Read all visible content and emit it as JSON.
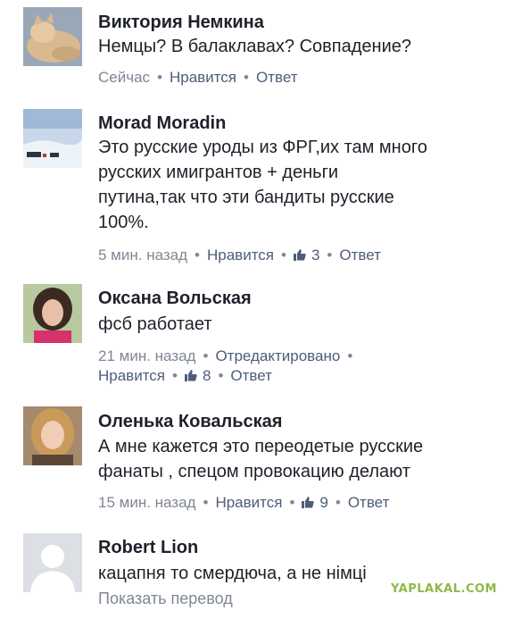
{
  "comments": [
    {
      "author": "Виктория Немкина",
      "avatar_icon": "cat-photo-avatar",
      "text_lines": [
        "Немцы?  В балаклавах?  Совпадение?"
      ],
      "time": "Сейчас",
      "like_label": "Нравится",
      "reply_label": "Ответ"
    },
    {
      "author": "Morad Moradin",
      "avatar_icon": "snow-landscape-avatar",
      "text_lines": [
        "Это русские уроды из ФРГ,их там много",
        "русских имигрантов + деньги",
        "путина,так что эти бандиты русские",
        "100%."
      ],
      "time": "5 мин. назад",
      "like_label": "Нравится",
      "likes": "3",
      "reply_label": "Ответ"
    },
    {
      "author": "Оксана Вольская",
      "avatar_icon": "woman-photo-avatar",
      "text_lines": [
        "фсб работает"
      ],
      "time": "21 мин. назад",
      "edited_label": "Отредактировано",
      "like_label": "Нравится",
      "likes": "8",
      "reply_label": "Ответ"
    },
    {
      "author": "Оленька Ковальская",
      "avatar_icon": "woman-photo-avatar",
      "text_lines": [
        "А мне кажется это переодетые русские",
        "фанаты , спецом провокацию делают"
      ],
      "time": "15 мин. назад",
      "like_label": "Нравится",
      "likes": "9",
      "reply_label": "Ответ"
    },
    {
      "author": "Robert Lion",
      "avatar_icon": "default-user-avatar",
      "text_lines": [
        "кацапня то смердюча, а не німці"
      ],
      "translate_label": "Показать перевод"
    }
  ],
  "watermark": "YAPLAKAL.COM",
  "colors": {
    "text": "#1d2129",
    "meta": "#7f8794",
    "link": "#4e5d78",
    "watermark": "#8fb84a"
  }
}
